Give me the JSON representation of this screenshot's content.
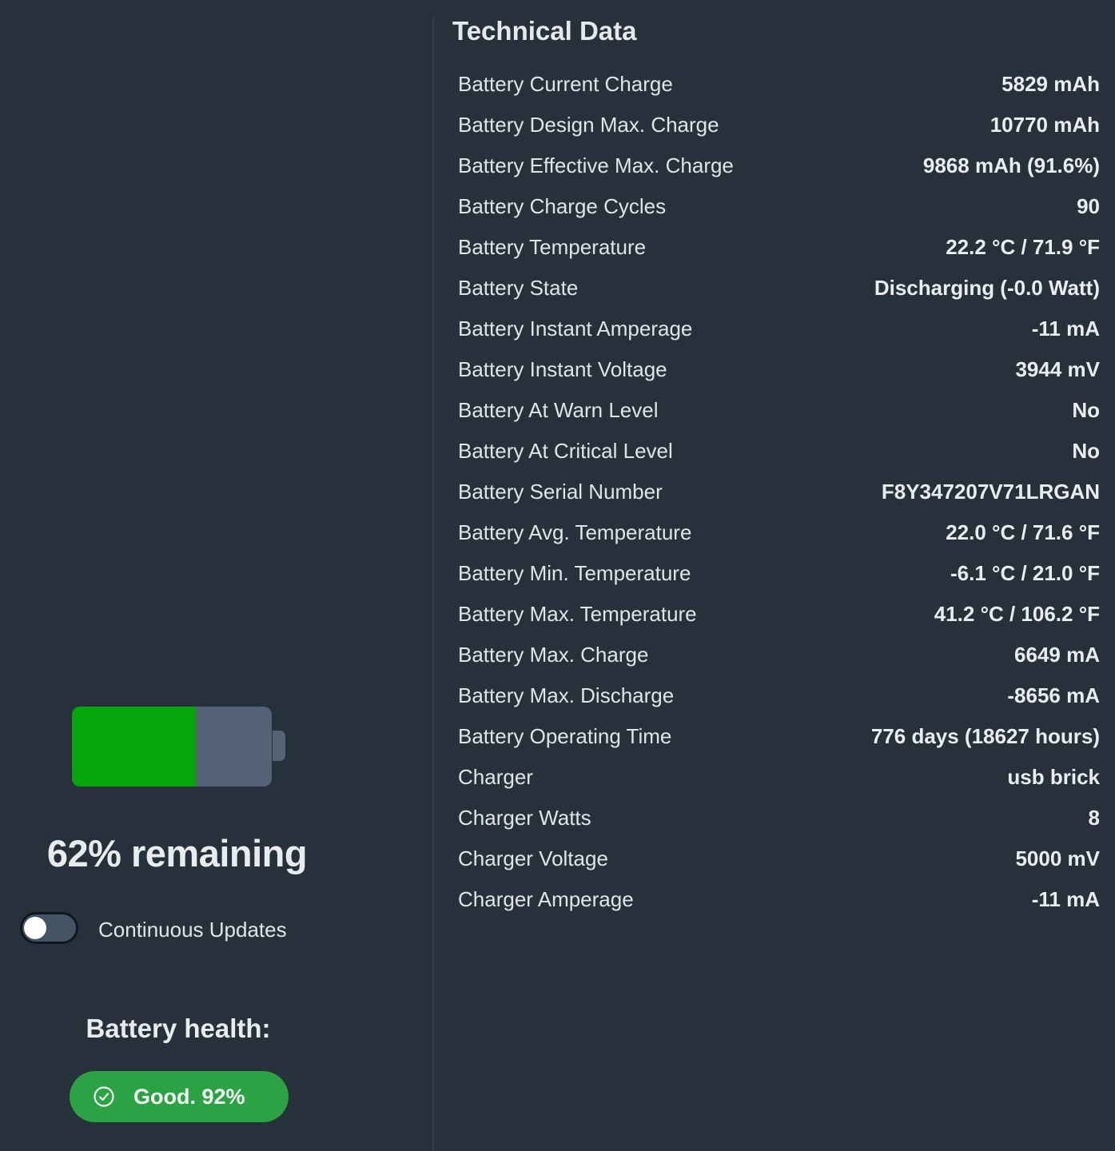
{
  "battery": {
    "level": 0.62,
    "remaining_text": "62% remaining"
  },
  "continuous_updates": {
    "label": "Continuous Updates",
    "enabled": false
  },
  "health": {
    "title": "Battery health:",
    "status": "Good. 92%",
    "icon": "check-circle-icon"
  },
  "technical": {
    "title": "Technical Data",
    "rows": [
      {
        "label": "Battery Current Charge",
        "value": "5829 mAh"
      },
      {
        "label": "Battery Design Max. Charge",
        "value": "10770 mAh"
      },
      {
        "label": "Battery Effective Max. Charge",
        "value": "9868 mAh (91.6%)"
      },
      {
        "label": "Battery Charge Cycles",
        "value": "90"
      },
      {
        "label": "Battery Temperature",
        "value": "22.2 °C / 71.9 °F"
      },
      {
        "label": "Battery State",
        "value": "Discharging (-0.0 Watt)"
      },
      {
        "label": "Battery Instant Amperage",
        "value": "-11 mA"
      },
      {
        "label": "Battery Instant Voltage",
        "value": "3944 mV"
      },
      {
        "label": "Battery At Warn Level",
        "value": "No"
      },
      {
        "label": "Battery At Critical Level",
        "value": "No"
      },
      {
        "label": "Battery Serial Number",
        "value": "F8Y347207V71LRGAN"
      },
      {
        "label": "Battery Avg. Temperature",
        "value": "22.0 °C / 71.6 °F"
      },
      {
        "label": "Battery Min. Temperature",
        "value": "-6.1 °C / 21.0 °F"
      },
      {
        "label": "Battery Max. Temperature",
        "value": "41.2 °C / 106.2 °F"
      },
      {
        "label": "Battery Max. Charge",
        "value": "6649 mA"
      },
      {
        "label": "Battery Max. Discharge",
        "value": "-8656 mA"
      },
      {
        "label": "Battery Operating Time",
        "value": "776 days (18627 hours)"
      },
      {
        "label": "Charger",
        "value": "usb brick"
      },
      {
        "label": "Charger Watts",
        "value": "8"
      },
      {
        "label": "Charger Voltage",
        "value": "5000 mV"
      },
      {
        "label": "Charger Amperage",
        "value": "-11 mA"
      }
    ]
  },
  "colors": {
    "background": "#27313c",
    "battery_fill": "#06a50c",
    "battery_empty": "#536274",
    "health_pill": "#2ba244"
  }
}
